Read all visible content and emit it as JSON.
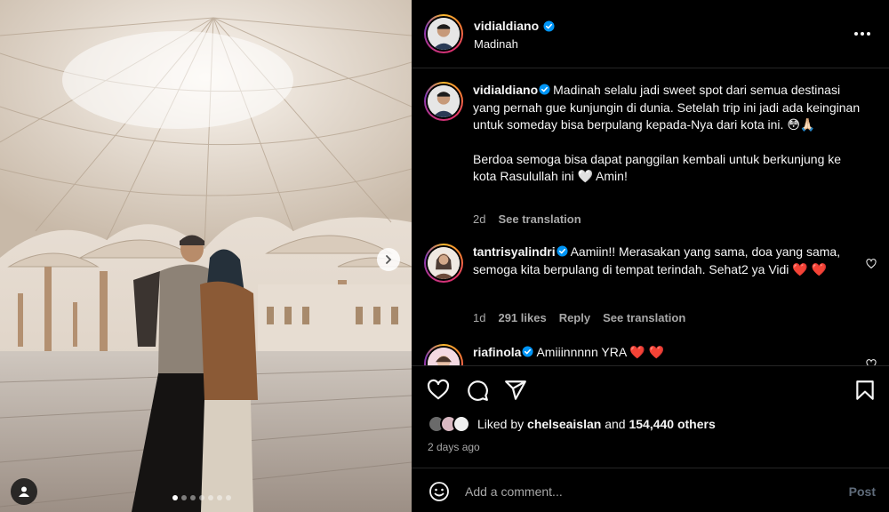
{
  "post": {
    "username": "vidialdiano",
    "location": "Madinah",
    "verified": true
  },
  "caption": {
    "username": "vidialdiano",
    "text": "Madinah selalu jadi sweet spot dari semua destinasi yang pernah gue kunjungin di dunia. Setelah trip ini jadi ada keinginan untuk someday bisa berpulang kepada-Nya dari kota ini. 😳🙏🏻",
    "text2": "Berdoa semoga bisa dapat panggilan kembali untuk berkunjung ke kota Rasulullah ini 🤍 Amin!",
    "time": "2d",
    "see_translation": "See translation"
  },
  "comments": [
    {
      "username": "tantrisyalindri",
      "verified": true,
      "text": "Aamiin!! Merasakan yang sama, doa yang sama, semoga kita berpulang di tempat terindah. Sehat2 ya Vidi ❤️ ❤️",
      "time": "1d",
      "likes": "291 likes",
      "reply": "Reply",
      "see_translation": "See translation"
    },
    {
      "username": "riafinola",
      "verified": true,
      "text": "Amiiinnnnn YRA ❤️ ❤️"
    }
  ],
  "likes": {
    "prefix": "Liked by",
    "user": "chelseaislan",
    "and": "and",
    "others": "154,440 others"
  },
  "date": "2 days ago",
  "add_comment": {
    "placeholder": "Add a comment...",
    "post_label": "Post"
  },
  "carousel": {
    "total": 7,
    "active_index": 0
  },
  "colors": {
    "background": "#000000",
    "text": "#f5f5f5",
    "muted": "#a8a8a8",
    "verified": "#0095f6",
    "heart": "#ff3040"
  }
}
